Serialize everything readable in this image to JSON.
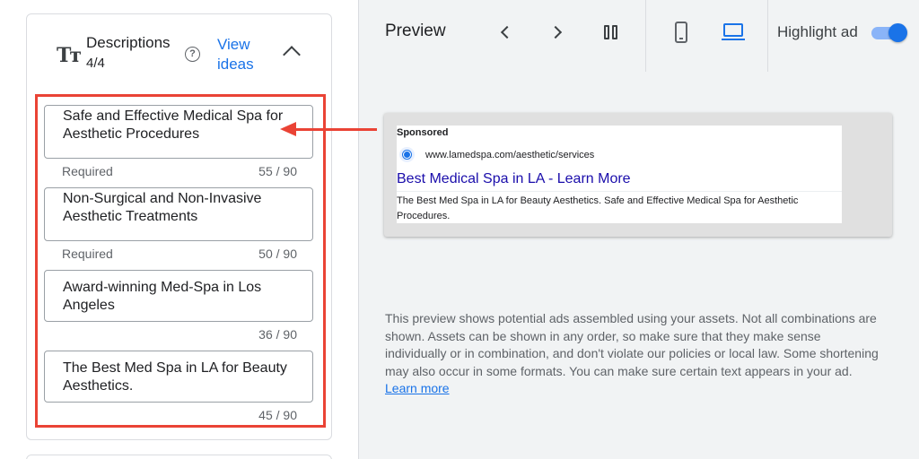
{
  "descriptions": {
    "title": "Descriptions",
    "count": "4/4",
    "help": "?",
    "view_ideas": "View ideas",
    "items": [
      {
        "text": "Safe and Effective Medical Spa for Aesthetic Procedures",
        "status": "Required",
        "count": "55 / 90"
      },
      {
        "text": "Non-Surgical and Non-Invasive Aesthetic Treatments",
        "status": "Required",
        "count": "50 / 90"
      },
      {
        "text": "Award-winning Med-Spa in Los Angeles",
        "status": "",
        "count": "36 / 90"
      },
      {
        "text": "The Best Med Spa in LA for Beauty Aesthetics.",
        "status": "",
        "count": "45 / 90"
      }
    ]
  },
  "preview": {
    "title": "Preview",
    "highlight_label": "Highlight ad",
    "highlight_on": true,
    "device_selected": "desktop"
  },
  "ad": {
    "sponsored": "Sponsored",
    "url": "www.lamedspa.com/aesthetic/services",
    "headline": "Best Medical Spa in LA - Learn More",
    "description": "The Best Med Spa in LA for Beauty Aesthetics. Safe and Effective Medical Spa for Aesthetic Procedures."
  },
  "info": {
    "text": "This preview shows potential ads assembled using your assets. Not all combinations are shown. Assets can be shown in any order, so make sure that they make sense individually or in combination, and don't violate our policies or local law. Some shortening may also occur in some formats. You can make sure certain text appears in your ad.",
    "learn_more": "Learn more"
  },
  "colors": {
    "accent": "#1a73e8",
    "highlight_red": "#ea4335",
    "ad_headline": "#1a0dab"
  }
}
